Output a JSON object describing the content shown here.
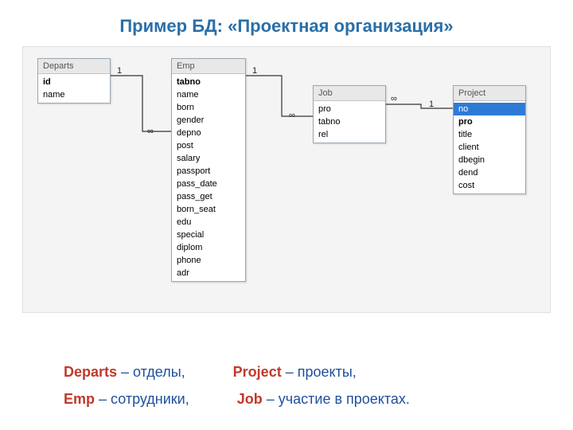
{
  "title": "Пример БД: «Проектная организация»",
  "tables": {
    "departs": {
      "name": "Departs",
      "fields": [
        {
          "n": "id",
          "pk": true
        },
        {
          "n": "name"
        }
      ]
    },
    "emp": {
      "name": "Emp",
      "fields": [
        {
          "n": "tabno",
          "pk": true
        },
        {
          "n": "name"
        },
        {
          "n": "born"
        },
        {
          "n": "gender"
        },
        {
          "n": "depno"
        },
        {
          "n": "post"
        },
        {
          "n": "salary"
        },
        {
          "n": "passport"
        },
        {
          "n": "pass_date"
        },
        {
          "n": "pass_get"
        },
        {
          "n": "born_seat"
        },
        {
          "n": "edu"
        },
        {
          "n": "special"
        },
        {
          "n": "diplom"
        },
        {
          "n": "phone"
        },
        {
          "n": "adr"
        }
      ]
    },
    "job": {
      "name": "Job",
      "fields": [
        {
          "n": "pro"
        },
        {
          "n": "tabno"
        },
        {
          "n": "rel"
        }
      ]
    },
    "project": {
      "name": "Project",
      "fields": [
        {
          "n": "no",
          "sel": true
        },
        {
          "n": "pro",
          "pk": true
        },
        {
          "n": "title"
        },
        {
          "n": "client"
        },
        {
          "n": "dbegin"
        },
        {
          "n": "dend"
        },
        {
          "n": "cost"
        }
      ]
    }
  },
  "cardinality": {
    "one": "1",
    "many": "∞"
  },
  "legend": {
    "departs_name": "Departs",
    "departs_desc": " – отделы,",
    "project_name": "Project",
    "project_desc": " – проекты,",
    "emp_name": "Emp",
    "emp_desc": " – сотрудники,",
    "job_name": "Job",
    "job_desc": " – участие в проектах."
  }
}
